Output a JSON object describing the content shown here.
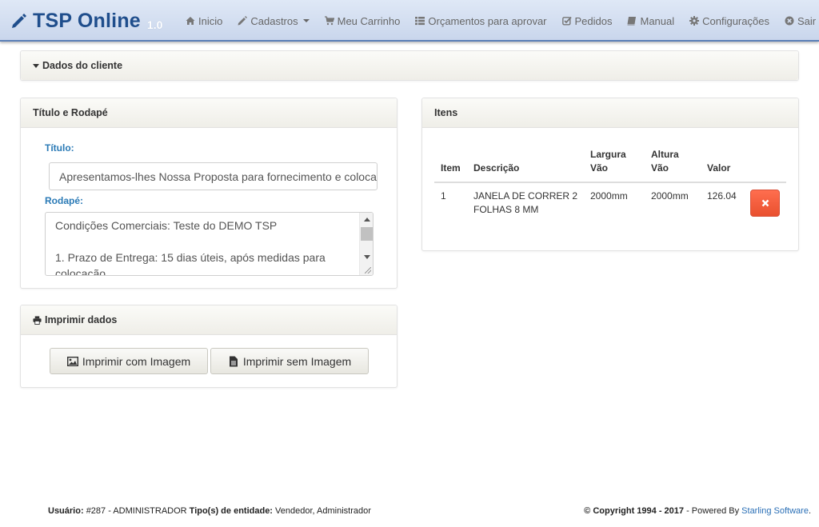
{
  "app": {
    "name": "TSP Online",
    "version": "1.0"
  },
  "nav": [
    {
      "label": "Inicio",
      "icon": "home-icon"
    },
    {
      "label": "Cadastros",
      "icon": "pencil-icon",
      "dropdown": true
    },
    {
      "label": "Meu Carrinho",
      "icon": "cart-icon"
    },
    {
      "label": "Orçamentos para aprovar",
      "icon": "list-icon"
    },
    {
      "label": "Pedidos",
      "icon": "check-square-icon"
    },
    {
      "label": "Manual",
      "icon": "book-icon"
    },
    {
      "label": "Configurações",
      "icon": "gear-icon"
    },
    {
      "label": "Sair",
      "icon": "close-circle-icon"
    }
  ],
  "cliente_panel": {
    "title": "Dados do cliente"
  },
  "titulo_panel": {
    "title": "Título e Rodapé",
    "titulo_label": "Título:",
    "titulo_value": "Apresentamos-lhes Nossa Proposta para fornecimento e colocação",
    "rodape_label": "Rodapé:",
    "rodape_lines": [
      "Condições Comerciais: Teste do DEMO TSP",
      "",
      "1. Prazo de Entrega: 15 dias úteis, após medidas para",
      "colocação"
    ]
  },
  "imprimir_panel": {
    "title": "Imprimir dados",
    "btn_com": "Imprimir com Imagem",
    "btn_sem": "Imprimir sem Imagem"
  },
  "itens_panel": {
    "title": "Itens",
    "headers": [
      "Item",
      "Descrição",
      "Largura Vão",
      "Altura Vão",
      "Valor"
    ],
    "rows": [
      {
        "item": "1",
        "descricao": "JANELA DE CORRER 2 FOLHAS 8 MM",
        "largura": "2000mm",
        "altura": "2000mm",
        "valor": "126.04"
      }
    ]
  },
  "footer": {
    "usuario_label": "Usuário:",
    "usuario_value": "#287 - ADMINISTRADOR",
    "tipo_label": "Tipo(s) de entidade:",
    "tipo_value": "Vendedor, Administrador",
    "copyright": "© Copyright 1994 - 2017",
    "powered": " - Powered By ",
    "company": "Starling Software",
    "period": "."
  }
}
